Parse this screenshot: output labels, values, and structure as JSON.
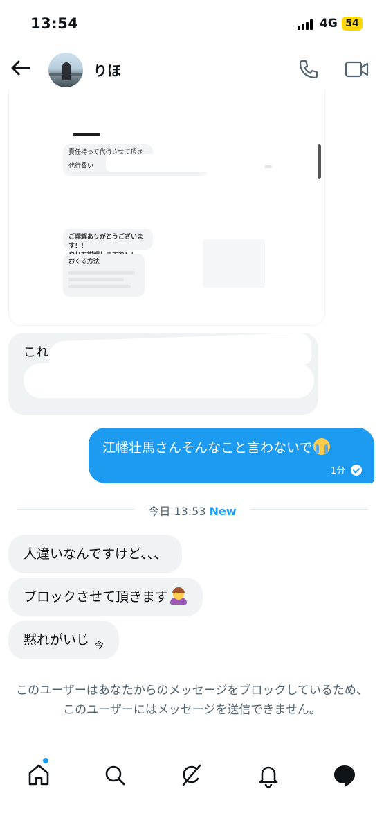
{
  "status_bar": {
    "time": "13:54",
    "network": "4G",
    "battery": "54"
  },
  "header": {
    "contact_name": "りほ"
  },
  "media_preview": {
    "bubble_1": "責任持って代行させて頂きます！！",
    "bubble_2": "代行費い",
    "bubble_3": "ご理解ありがとうございます！！\nやり方説明しますね！！",
    "bubble_4_title": "おくる方法"
  },
  "redacted_message": {
    "prefix": "これ"
  },
  "sent_message": {
    "text": "江幡壮馬さんそんなこと言わないで",
    "time": "1分"
  },
  "separator": {
    "label": "今日 13:53",
    "new_label": "New"
  },
  "received_messages": [
    {
      "text": "人違いなんですけど、、、"
    },
    {
      "text": "ブロックさせて頂きます"
    },
    {
      "text": "黙れがいじ",
      "time": "今"
    }
  ],
  "blocked_notice": "このユーザーはあなたからのメッセージをブロックしているため、このユーザーにはメッセージを送信できません。",
  "bottom_nav": [
    "home-icon",
    "search-icon",
    "grok-icon",
    "notifications-icon",
    "messages-icon"
  ],
  "colors": {
    "accent": "#1d9bf0",
    "received_bubble": "#eff3f4",
    "muted_text": "#536471"
  }
}
